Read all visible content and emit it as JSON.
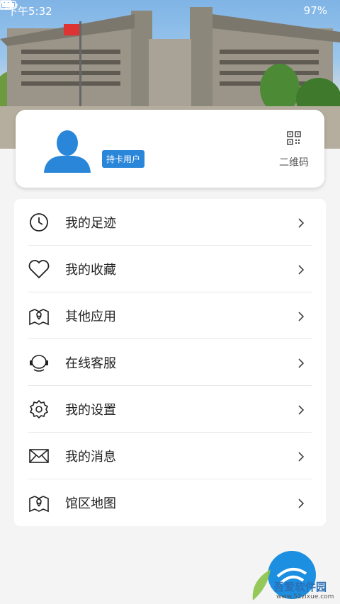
{
  "status_bar": {
    "time": "下午5:32",
    "battery_percent": "97%"
  },
  "profile": {
    "badge": "持卡用户",
    "qr_label": "二维码"
  },
  "menu": {
    "items": [
      {
        "label": "我的足迹",
        "icon": "clock-icon"
      },
      {
        "label": "我的收藏",
        "icon": "heart-icon"
      },
      {
        "label": "其他应用",
        "icon": "map-pin-icon"
      },
      {
        "label": "在线客服",
        "icon": "headset-icon"
      },
      {
        "label": "我的设置",
        "icon": "gear-icon"
      },
      {
        "label": "我的消息",
        "icon": "mail-icon"
      },
      {
        "label": "馆区地图",
        "icon": "map-icon"
      }
    ]
  },
  "watermark": {
    "title": "吾爱软件园",
    "url": "www.52zixue.com"
  },
  "colors": {
    "accent": "#2a86d8",
    "background": "#f4f4f4"
  }
}
